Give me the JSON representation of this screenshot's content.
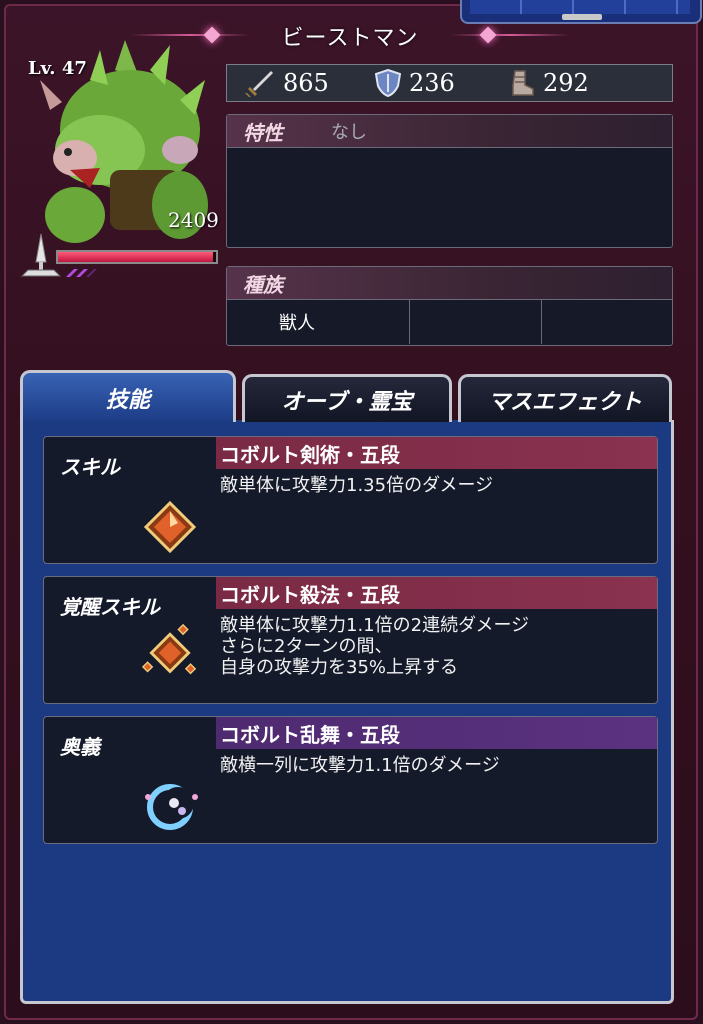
{
  "character": {
    "name": "ビーストマン",
    "level": "Lv. 47",
    "hp": "2409",
    "hp_fill": 0.98
  },
  "stats": [
    {
      "icon": "sword-icon",
      "value": "865"
    },
    {
      "icon": "shield-icon",
      "value": "236"
    },
    {
      "icon": "boot-icon",
      "value": "292"
    }
  ],
  "trait": {
    "label": "特性",
    "value": "なし"
  },
  "race": {
    "label": "種族",
    "cells": [
      "獣人",
      "",
      ""
    ]
  },
  "tabs": [
    {
      "label": "技能",
      "active": true
    },
    {
      "label": "オーブ・霊宝",
      "active": false
    },
    {
      "label": "マスエフェクト",
      "active": false
    }
  ],
  "skills": [
    {
      "type": "スキル",
      "name": "コボルト剣術・五段",
      "desc": [
        "敵単体に攻撃力1.35倍のダメージ"
      ],
      "header_color": "#7a2a44"
    },
    {
      "type": "覚醒スキル",
      "name": "コボルト殺法・五段",
      "desc": [
        "敵単体に攻撃力1.1倍の2連続ダメージ",
        "さらに2ターンの間、",
        "自身の攻撃力を35%上昇する"
      ],
      "header_color": "#7a2a44"
    },
    {
      "type": "奥義",
      "name": "コボルト乱舞・五段",
      "desc": [
        "敵横一列に攻撃力1.1倍のダメージ"
      ],
      "header_color": "#4e2a70"
    }
  ]
}
